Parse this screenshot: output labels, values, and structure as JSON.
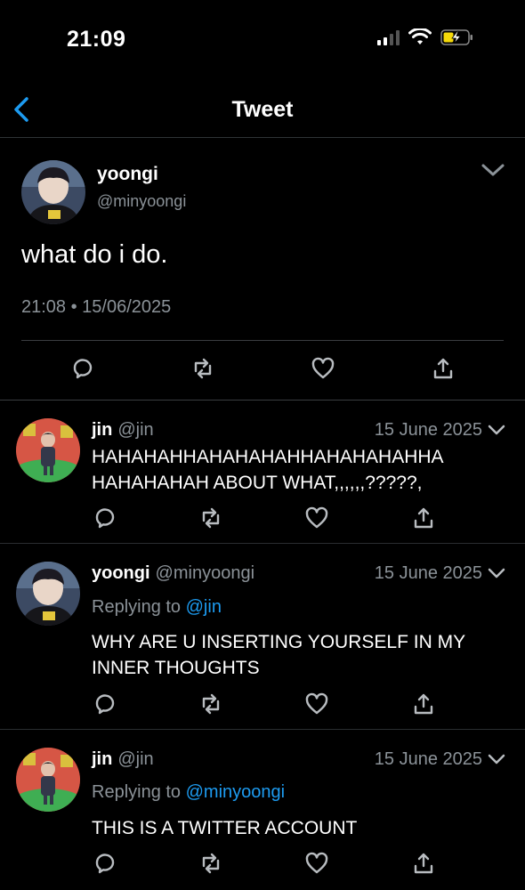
{
  "status_bar": {
    "time": "21:09"
  },
  "nav": {
    "title": "Tweet"
  },
  "main_tweet": {
    "name": "yoongi",
    "handle": "@minyoongi",
    "text": "what do i do.",
    "timestamp": "21:08 • 15/06/2025"
  },
  "replies": [
    {
      "name": "jin",
      "handle": "@jin",
      "date": "15 June 2025",
      "replying_prefix": "",
      "replying_to": "",
      "lines": [
        "HAHAHAHHAHAHAHAHHAHAHAHAHHA",
        "HAHAHAHAH ABOUT WHAT,,,,,,?????,"
      ]
    },
    {
      "name": "yoongi",
      "handle": "@minyoongi",
      "date": "15 June 2025",
      "replying_prefix": "Replying to",
      "replying_to": "@jin",
      "lines": [
        "WHY ARE U INSERTING YOURSELF IN MY",
        "INNER THOUGHTS"
      ]
    },
    {
      "name": "jin",
      "handle": "@jin",
      "date": "15 June 2025",
      "replying_prefix": "Replying to",
      "replying_to": "@minyoongi",
      "lines": [
        "THIS IS A TWITTER ACCOUNT"
      ]
    }
  ],
  "icons": {
    "reply": "reply-icon",
    "retweet": "retweet-icon",
    "like": "heart-icon",
    "share": "share-icon"
  },
  "colors": {
    "accent": "#1d9bf0",
    "muted": "#8b9298",
    "background": "#000000"
  }
}
